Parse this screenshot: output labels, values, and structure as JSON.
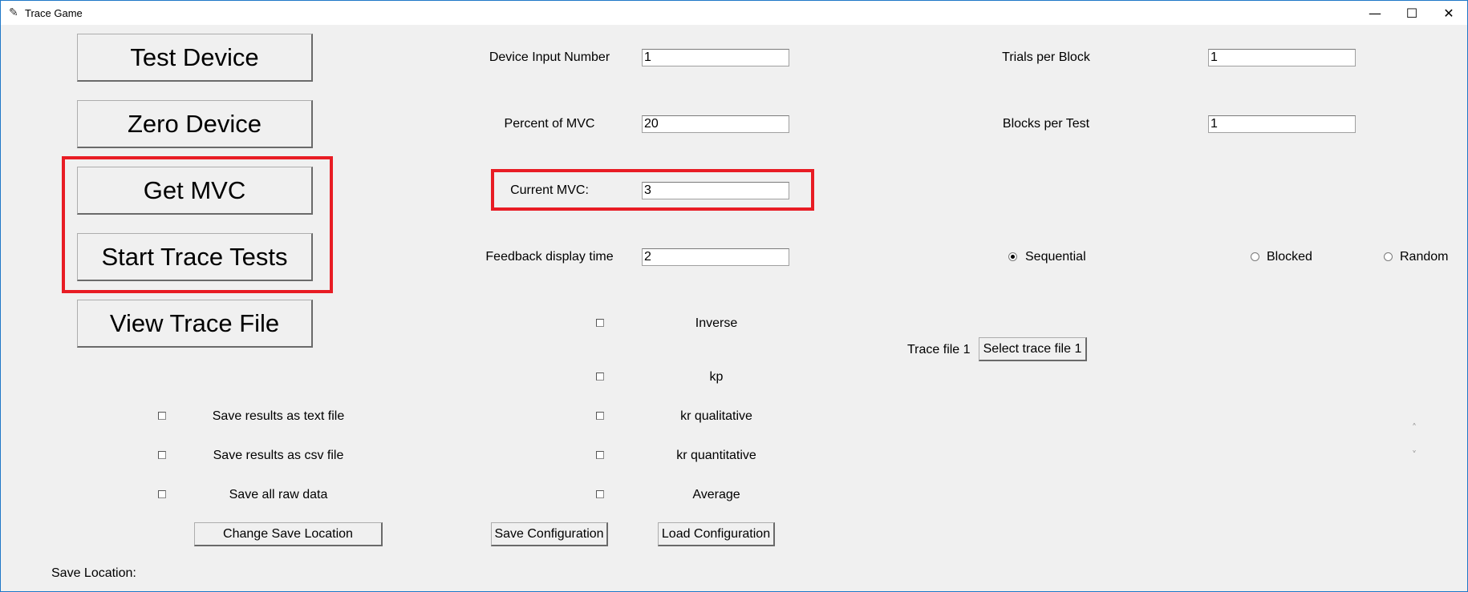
{
  "window": {
    "title": "Trace Game",
    "minimize_glyph": "—",
    "maximize_glyph": "☐",
    "close_glyph": "✕",
    "app_icon_glyph": "✎"
  },
  "left_buttons": {
    "test_device": "Test Device",
    "zero_device": "Zero Device",
    "get_mvc": "Get MVC",
    "start_trace_tests": "Start Trace Tests",
    "view_trace_file": "View Trace File"
  },
  "fields": {
    "device_input_number": {
      "label": "Device Input Number",
      "value": "1"
    },
    "percent_of_mvc": {
      "label": "Percent of MVC",
      "value": "20"
    },
    "current_mvc": {
      "label": "Current MVC:",
      "value": "3"
    },
    "feedback_display_time": {
      "label": "Feedback display time",
      "value": "2"
    },
    "trials_per_block": {
      "label": "Trials per Block",
      "value": "1"
    },
    "blocks_per_test": {
      "label": "Blocks per Test",
      "value": "1"
    }
  },
  "order_mode": {
    "options": [
      "Sequential",
      "Blocked",
      "Random"
    ],
    "selected": "Sequential"
  },
  "feedback_options": [
    {
      "label": "Inverse",
      "checked": false
    },
    {
      "label": "kp",
      "checked": false
    },
    {
      "label": "kr qualitative",
      "checked": false
    },
    {
      "label": "kr quantitative",
      "checked": false
    },
    {
      "label": "Average",
      "checked": false
    }
  ],
  "save_options": [
    {
      "label": "Save results as text file",
      "checked": false
    },
    {
      "label": "Save results as csv file",
      "checked": false
    },
    {
      "label": "Save all raw data",
      "checked": false
    }
  ],
  "trace_file": {
    "label": "Trace file 1",
    "button": "Select trace file 1"
  },
  "bottom_buttons": {
    "change_save_location": "Change Save Location",
    "save_configuration": "Save Configuration",
    "load_configuration": "Load Configuration"
  },
  "save_location_label": "Save Location:",
  "scroll": {
    "up_glyph": "˄",
    "down_glyph": "˅"
  },
  "colors": {
    "highlight": "#e81c24",
    "window_border": "#1f78c8"
  }
}
